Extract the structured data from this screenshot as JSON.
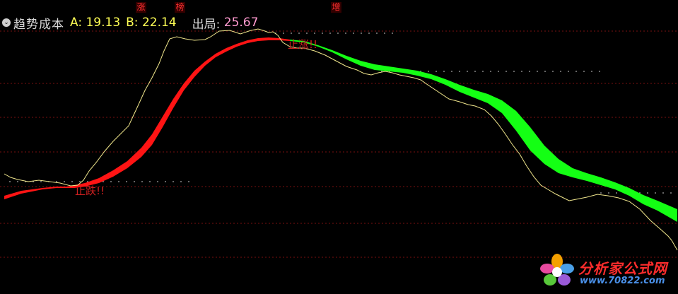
{
  "header": {
    "collapse_glyph": "⌄",
    "indicator_name": "趋势成本",
    "a_label": "A:",
    "a_value": "19.13",
    "b_label": "B:",
    "b_value": "22.14",
    "exit_label": "出局:",
    "exit_value": "25.67"
  },
  "top_markers": [
    {
      "label": "涨"
    },
    {
      "label": "榜"
    },
    {
      "label": "增"
    }
  ],
  "signal_labels": {
    "low_signal": "止跌!!",
    "high_signal": "止涨!!"
  },
  "watermark": {
    "title": "分析家公式网",
    "url": "www.70822.com"
  },
  "colors": {
    "background": "#000000",
    "grid": "#7a1010",
    "ribbon_up": "#ff1414",
    "ribbon_down": "#14ff14",
    "price_line": "#f0e68c",
    "header_value": "#ffff55",
    "exit_value": "#ff9ad0",
    "signal_text": "#d02020",
    "dots": "#b0b0b0"
  },
  "chart_data": {
    "type": "line",
    "y_domain": [
      100,
      0
    ],
    "grid": true,
    "series": [
      {
        "role": "price",
        "values": [
          [
            6,
            246
          ],
          [
            15,
            251
          ],
          [
            25,
            254
          ],
          [
            40,
            257
          ],
          [
            55,
            255
          ],
          [
            70,
            257
          ],
          [
            85,
            259
          ],
          [
            100,
            263
          ],
          [
            110,
            262
          ],
          [
            118,
            255
          ],
          [
            126,
            242
          ],
          [
            136,
            230
          ],
          [
            148,
            214
          ],
          [
            160,
            200
          ],
          [
            172,
            188
          ],
          [
            182,
            178
          ],
          [
            188,
            165
          ],
          [
            195,
            150
          ],
          [
            205,
            128
          ],
          [
            215,
            110
          ],
          [
            225,
            90
          ],
          [
            232,
            72
          ],
          [
            240,
            55
          ],
          [
            250,
            52
          ],
          [
            262,
            55
          ],
          [
            275,
            57
          ],
          [
            290,
            56
          ],
          [
            298,
            52
          ],
          [
            310,
            44
          ],
          [
            325,
            43
          ],
          [
            340,
            48
          ],
          [
            355,
            43
          ],
          [
            365,
            41
          ],
          [
            372,
            43
          ],
          [
            380,
            46
          ],
          [
            386,
            45
          ],
          [
            393,
            50
          ],
          [
            400,
            60
          ],
          [
            410,
            66
          ],
          [
            420,
            68
          ],
          [
            430,
            68
          ],
          [
            445,
            72
          ],
          [
            460,
            78
          ],
          [
            475,
            86
          ],
          [
            490,
            94
          ],
          [
            505,
            99
          ],
          [
            515,
            104
          ],
          [
            525,
            106
          ],
          [
            535,
            103
          ],
          [
            545,
            101
          ],
          [
            555,
            103
          ],
          [
            565,
            106
          ],
          [
            575,
            108
          ],
          [
            585,
            110
          ],
          [
            595,
            113
          ],
          [
            605,
            120
          ],
          [
            620,
            130
          ],
          [
            635,
            140
          ],
          [
            650,
            144
          ],
          [
            662,
            148
          ],
          [
            672,
            150
          ],
          [
            685,
            155
          ],
          [
            695,
            164
          ],
          [
            705,
            176
          ],
          [
            715,
            190
          ],
          [
            725,
            205
          ],
          [
            735,
            218
          ],
          [
            745,
            235
          ],
          [
            755,
            250
          ],
          [
            765,
            262
          ],
          [
            775,
            268
          ],
          [
            785,
            274
          ],
          [
            795,
            279
          ],
          [
            805,
            284
          ],
          [
            815,
            282
          ],
          [
            830,
            279
          ],
          [
            845,
            275
          ],
          [
            860,
            277
          ],
          [
            875,
            280
          ],
          [
            890,
            285
          ],
          [
            905,
            296
          ],
          [
            920,
            312
          ],
          [
            935,
            325
          ],
          [
            945,
            334
          ],
          [
            950,
            340
          ],
          [
            958,
            354
          ]
        ]
      },
      {
        "role": "ribbon",
        "segments": [
          {
            "color": "up",
            "upper": [
              [
                6,
                277
              ],
              [
                30,
                270
              ],
              [
                60,
                266
              ],
              [
                80,
                264
              ],
              [
                95,
                264
              ],
              [
                105,
                262
              ],
              [
                120,
                259
              ],
              [
                140,
                252
              ],
              [
                160,
                241
              ],
              [
                180,
                228
              ],
              [
                200,
                209
              ],
              [
                215,
                190
              ],
              [
                230,
                165
              ],
              [
                245,
                140
              ],
              [
                260,
                118
              ],
              [
                275,
                100
              ],
              [
                290,
                87
              ],
              [
                305,
                76
              ],
              [
                320,
                68
              ],
              [
                335,
                62
              ],
              [
                350,
                57
              ],
              [
                365,
                54
              ],
              [
                380,
                53
              ],
              [
                395,
                54
              ],
              [
                410,
                56
              ]
            ],
            "lower": [
              [
                6,
                282
              ],
              [
                30,
                274
              ],
              [
                60,
                268
              ],
              [
                80,
                266
              ],
              [
                95,
                266
              ],
              [
                105,
                266
              ],
              [
                120,
                264
              ],
              [
                140,
                259
              ],
              [
                160,
                250
              ],
              [
                180,
                238
              ],
              [
                200,
                222
              ],
              [
                215,
                205
              ],
              [
                230,
                180
              ],
              [
                245,
                153
              ],
              [
                260,
                128
              ],
              [
                275,
                109
              ],
              [
                290,
                93
              ],
              [
                305,
                81
              ],
              [
                320,
                73
              ],
              [
                335,
                66
              ],
              [
                350,
                61
              ],
              [
                365,
                58
              ],
              [
                380,
                57
              ],
              [
                395,
                57
              ],
              [
                410,
                58
              ]
            ]
          },
          {
            "color": "down",
            "upper": [
              [
                410,
                56
              ],
              [
                430,
                58
              ],
              [
                450,
                64
              ],
              [
                470,
                71
              ],
              [
                490,
                79
              ],
              [
                510,
                86
              ],
              [
                530,
                91
              ],
              [
                550,
                94
              ],
              [
                570,
                97
              ],
              [
                590,
                100
              ],
              [
                610,
                105
              ],
              [
                630,
                112
              ],
              [
                650,
                120
              ],
              [
                670,
                127
              ],
              [
                690,
                133
              ],
              [
                710,
                142
              ],
              [
                730,
                157
              ],
              [
                750,
                180
              ],
              [
                770,
                206
              ],
              [
                790,
                225
              ],
              [
                810,
                238
              ],
              [
                830,
                245
              ],
              [
                850,
                251
              ],
              [
                870,
                258
              ],
              [
                890,
                266
              ],
              [
                910,
                276
              ],
              [
                930,
                284
              ],
              [
                958,
                296
              ]
            ],
            "lower": [
              [
                410,
                58
              ],
              [
                430,
                60
              ],
              [
                450,
                66
              ],
              [
                470,
                74
              ],
              [
                490,
                84
              ],
              [
                510,
                93
              ],
              [
                530,
                99
              ],
              [
                550,
                101
              ],
              [
                570,
                103
              ],
              [
                590,
                107
              ],
              [
                610,
                112
              ],
              [
                630,
                120
              ],
              [
                650,
                130
              ],
              [
                670,
                138
              ],
              [
                690,
                146
              ],
              [
                710,
                160
              ],
              [
                730,
                185
              ],
              [
                750,
                213
              ],
              [
                770,
                232
              ],
              [
                790,
                245
              ],
              [
                810,
                251
              ],
              [
                830,
                256
              ],
              [
                850,
                262
              ],
              [
                870,
                268
              ],
              [
                890,
                277
              ],
              [
                910,
                289
              ],
              [
                930,
                298
              ],
              [
                958,
                314
              ]
            ]
          }
        ]
      }
    ],
    "dotted_levels": [
      {
        "y": 257,
        "x_start": 14,
        "x_end": 270
      },
      {
        "y": 47,
        "x_start": 390,
        "x_end": 560
      },
      {
        "y": 101,
        "x_start": 540,
        "x_end": 850
      },
      {
        "y": 273,
        "x_start": 850,
        "x_end": 950
      }
    ]
  }
}
